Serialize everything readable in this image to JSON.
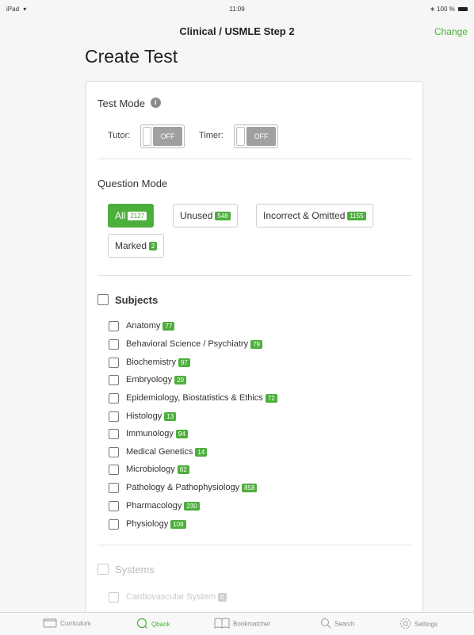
{
  "status_bar": {
    "left": "iPad",
    "time": "11:09",
    "battery": "100 %"
  },
  "nav": {
    "title": "Clinical / USMLE Step 2",
    "change_label": "Change"
  },
  "page_title": "Create Test",
  "test_mode": {
    "title": "Test Mode",
    "tutor_label": "Tutor:",
    "tutor_value": "OFF",
    "timer_label": "Timer:",
    "timer_value": "OFF"
  },
  "question_mode": {
    "title": "Question Mode",
    "options": [
      {
        "label": "All",
        "count": "2127"
      },
      {
        "label": "Unused",
        "count": "548"
      },
      {
        "label": "Incorrect & Omitted",
        "count": "1155"
      },
      {
        "label": "Marked",
        "count": "2"
      }
    ],
    "selected": "All"
  },
  "subjects": {
    "title": "Subjects",
    "items": [
      {
        "label": "Anatomy",
        "count": "77"
      },
      {
        "label": "Behavioral Science / Psychiatry",
        "count": "79"
      },
      {
        "label": "Biochemistry",
        "count": "97"
      },
      {
        "label": "Embryology",
        "count": "20"
      },
      {
        "label": "Epidemiology, Biostatistics & Ethics",
        "count": "72"
      },
      {
        "label": "Histology",
        "count": "13"
      },
      {
        "label": "Immunology",
        "count": "94"
      },
      {
        "label": "Medical Genetics",
        "count": "14"
      },
      {
        "label": "Microbiology",
        "count": "82"
      },
      {
        "label": "Pathology & Pathophysiology",
        "count": "858"
      },
      {
        "label": "Pharmacology",
        "count": "230"
      },
      {
        "label": "Physiology",
        "count": "108"
      }
    ]
  },
  "systems": {
    "title": "Systems",
    "items": [
      {
        "label": "Cardiovascular System",
        "count": "0"
      }
    ]
  },
  "tab_bar": {
    "tabs": [
      {
        "label": "Curriculum",
        "icon": "folder-icon"
      },
      {
        "label": "Qbank",
        "icon": "qbank-icon"
      },
      {
        "label": "Bookmatcher",
        "icon": "book-icon"
      },
      {
        "label": "Search",
        "icon": "search-icon"
      },
      {
        "label": "Settings",
        "icon": "gear-icon"
      }
    ],
    "active": "Qbank"
  },
  "colors": {
    "accent": "#4caf3c",
    "toggle_off": "#a0a0a0",
    "disabled_text": "#c8c8c8"
  }
}
